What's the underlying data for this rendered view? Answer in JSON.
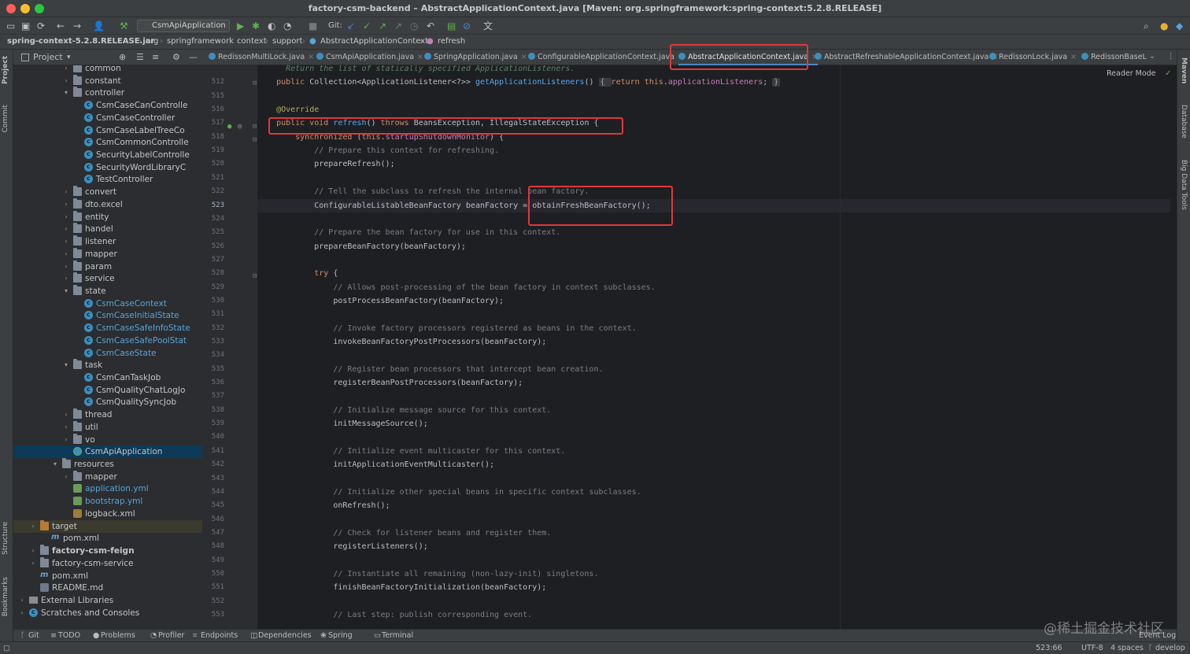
{
  "window": {
    "title": "factory-csm-backend – AbstractApplicationContext.java [Maven: org.springframework:spring-context:5.2.8.RELEASE]",
    "traffic_colors": [
      "#fe5f57",
      "#febc2e",
      "#28c840"
    ]
  },
  "toolbar": {
    "run_config": "CsmApiApplication",
    "git_label": "Git:"
  },
  "breadcrumb": [
    "spring-context-5.2.8.RELEASE.jar",
    "org",
    "springframework",
    "context",
    "support",
    "AbstractApplicationContext",
    "refresh"
  ],
  "left_strip": {
    "project": "Project",
    "commit": "Commit",
    "structure": "Structure",
    "bookmarks": "Bookmarks"
  },
  "right_strip": {
    "maven": "Maven",
    "database": "Database",
    "bigdata": "Big Data Tools"
  },
  "project_panel": {
    "title": "Project"
  },
  "tree": [
    {
      "label": "common",
      "icon": "folder-icon",
      "depth": 4,
      "chevron": "›"
    },
    {
      "label": "constant",
      "icon": "folder-icon",
      "depth": 4,
      "chevron": "›"
    },
    {
      "label": "controller",
      "icon": "folder-icon",
      "depth": 4,
      "chevron": "⌄"
    },
    {
      "label": "CsmCaseCanControlle",
      "icon": "class-icon",
      "depth": 5
    },
    {
      "label": "CsmCaseController",
      "icon": "class-icon",
      "depth": 5
    },
    {
      "label": "CsmCaseLabelTreeCo",
      "icon": "class-icon",
      "depth": 5
    },
    {
      "label": "CsmCommonControlle",
      "icon": "class-icon",
      "depth": 5
    },
    {
      "label": "SecurityLabelControlle",
      "icon": "class-icon",
      "depth": 5
    },
    {
      "label": "SecurityWordLibraryC",
      "icon": "class-icon",
      "depth": 5
    },
    {
      "label": "TestController",
      "icon": "class-icon",
      "depth": 5
    },
    {
      "label": "convert",
      "icon": "folder-icon",
      "depth": 4,
      "chevron": "›"
    },
    {
      "label": "dto.excel",
      "icon": "folder-icon",
      "depth": 4,
      "chevron": "›"
    },
    {
      "label": "entity",
      "icon": "folder-icon",
      "depth": 4,
      "chevron": "›"
    },
    {
      "label": "handel",
      "icon": "folder-icon",
      "depth": 4,
      "chevron": "›"
    },
    {
      "label": "listener",
      "icon": "folder-icon",
      "depth": 4,
      "chevron": "›"
    },
    {
      "label": "mapper",
      "icon": "folder-icon",
      "depth": 4,
      "chevron": "›"
    },
    {
      "label": "param",
      "icon": "folder-icon",
      "depth": 4,
      "chevron": "›"
    },
    {
      "label": "service",
      "icon": "folder-icon",
      "depth": 4,
      "chevron": "›"
    },
    {
      "label": "state",
      "icon": "folder-icon",
      "depth": 4,
      "chevron": "⌄"
    },
    {
      "label": "CsmCaseContext",
      "icon": "class-icon",
      "depth": 5,
      "blue": true
    },
    {
      "label": "CsmCaseInitialState",
      "icon": "class-icon",
      "depth": 5,
      "blue": true
    },
    {
      "label": "CsmCaseSafeInfoState",
      "icon": "class-icon",
      "depth": 5,
      "blue": true
    },
    {
      "label": "CsmCaseSafePoolStat",
      "icon": "class-icon",
      "depth": 5,
      "blue": true
    },
    {
      "label": "CsmCaseState",
      "icon": "class-icon",
      "depth": 5,
      "blue": true
    },
    {
      "label": "task",
      "icon": "folder-icon",
      "depth": 4,
      "chevron": "⌄"
    },
    {
      "label": "CsmCanTaskJob",
      "icon": "class-icon",
      "depth": 5
    },
    {
      "label": "CsmQualityChatLogJo",
      "icon": "class-icon",
      "depth": 5
    },
    {
      "label": "CsmQualitySyncJob",
      "icon": "class-icon",
      "depth": 5
    },
    {
      "label": "thread",
      "icon": "folder-icon",
      "depth": 4,
      "chevron": "›"
    },
    {
      "label": "util",
      "icon": "folder-icon",
      "depth": 4,
      "chevron": "›"
    },
    {
      "label": "vo",
      "icon": "folder-icon",
      "depth": 4,
      "chevron": "›"
    },
    {
      "label": "CsmApiApplication",
      "icon": "app-class-icon",
      "depth": 4,
      "selected": true
    },
    {
      "label": "resources",
      "icon": "folder-icon",
      "depth": 3,
      "chevron": "⌄"
    },
    {
      "label": "mapper",
      "icon": "folder-icon",
      "depth": 4,
      "chevron": "›"
    },
    {
      "label": "application.yml",
      "icon": "yaml-icon",
      "depth": 4,
      "blue": true
    },
    {
      "label": "bootstrap.yml",
      "icon": "yaml-icon",
      "depth": 4,
      "blue": true
    },
    {
      "label": "logback.xml",
      "icon": "xml-icon",
      "depth": 4
    },
    {
      "label": "target",
      "icon": "folder-orange-icon",
      "depth": 1,
      "chevron": "›",
      "highlight": true
    },
    {
      "label": "pom.xml",
      "icon": "maven-icon",
      "depth": 2
    },
    {
      "label": "factory-csm-feign",
      "icon": "folder-icon",
      "depth": 1,
      "chevron": "›",
      "bold": true
    },
    {
      "label": "factory-csm-service",
      "icon": "folder-icon",
      "depth": 1,
      "chevron": "›"
    },
    {
      "label": "pom.xml",
      "icon": "maven-icon",
      "depth": 1
    },
    {
      "label": "README.md",
      "icon": "markdown-icon",
      "depth": 1
    },
    {
      "label": "External Libraries",
      "icon": "library-icon",
      "depth": 0,
      "chevron": "›"
    },
    {
      "label": "Scratches and Consoles",
      "icon": "scratch-icon",
      "depth": 0,
      "chevron": "›"
    }
  ],
  "tabs": [
    {
      "label": "RedissonMultiLock.java"
    },
    {
      "label": "CsmApiApplication.java"
    },
    {
      "label": "SpringApplication.java"
    },
    {
      "label": "ConfigurableApplicationContext.java"
    },
    {
      "label": "AbstractApplicationContext.java",
      "active": true
    },
    {
      "label": "AbstractRefreshableApplicationContext.java"
    },
    {
      "label": "RedissonLock.java"
    },
    {
      "label": "RedissonBaseL"
    }
  ],
  "editor": {
    "reader_mode": "Reader Mode",
    "lines": [
      {
        "n": "",
        "tokens": [
          [
            "doc",
            "      Return the list of statically specified ApplicationListeners."
          ]
        ]
      },
      {
        "n": "512",
        "tokens": [
          [
            "kw",
            "    public "
          ],
          [
            "df",
            "Collection<ApplicationListener<?>> "
          ],
          [
            "fn",
            "getApplicationListeners"
          ],
          [
            "df",
            "() "
          ],
          [
            "fold",
            "{ "
          ],
          [
            "kw",
            "return this"
          ],
          [
            "df",
            "."
          ],
          [
            "fld",
            "applicationListeners"
          ],
          [
            "df",
            "; "
          ],
          [
            "fold",
            "}"
          ]
        ]
      },
      {
        "n": "515",
        "tokens": []
      },
      {
        "n": "516",
        "tokens": [
          [
            "an",
            "    @Override"
          ]
        ]
      },
      {
        "n": "517",
        "tokens": [
          [
            "kw",
            "    public void "
          ],
          [
            "fn",
            "refresh"
          ],
          [
            "df",
            "() "
          ],
          [
            "kw",
            "throws "
          ],
          [
            "df",
            "BeansException, IllegalStateException {"
          ]
        ]
      },
      {
        "n": "518",
        "tokens": [
          [
            "kw",
            "        synchronized "
          ],
          [
            "df",
            "("
          ],
          [
            "kw",
            "this"
          ],
          [
            "df",
            "."
          ],
          [
            "fld",
            "startupShutdownMonitor"
          ],
          [
            "df",
            ") {"
          ]
        ]
      },
      {
        "n": "519",
        "tokens": [
          [
            "cm",
            "            // Prepare this context for refreshing."
          ]
        ]
      },
      {
        "n": "520",
        "tokens": [
          [
            "df",
            "            prepareRefresh();"
          ]
        ]
      },
      {
        "n": "521",
        "tokens": []
      },
      {
        "n": "522",
        "tokens": [
          [
            "cm",
            "            // Tell the subclass to refresh the internal bean factory."
          ]
        ]
      },
      {
        "n": "523",
        "tokens": [
          [
            "df",
            "            ConfigurableListableBeanFactory beanFactory = obtainFreshBeanFactory();"
          ]
        ],
        "current": true
      },
      {
        "n": "524",
        "tokens": []
      },
      {
        "n": "525",
        "tokens": [
          [
            "cm",
            "            // Prepare the bean factory for use in this context."
          ]
        ]
      },
      {
        "n": "526",
        "tokens": [
          [
            "df",
            "            prepareBeanFactory(beanFactory);"
          ]
        ]
      },
      {
        "n": "527",
        "tokens": []
      },
      {
        "n": "528",
        "tokens": [
          [
            "kw",
            "            try "
          ],
          [
            "df",
            "{"
          ]
        ]
      },
      {
        "n": "529",
        "tokens": [
          [
            "cm",
            "                // Allows post-processing of the bean factory in context subclasses."
          ]
        ]
      },
      {
        "n": "530",
        "tokens": [
          [
            "df",
            "                postProcessBeanFactory(beanFactory);"
          ]
        ]
      },
      {
        "n": "531",
        "tokens": []
      },
      {
        "n": "532",
        "tokens": [
          [
            "cm",
            "                // Invoke factory processors registered as beans in the context."
          ]
        ]
      },
      {
        "n": "533",
        "tokens": [
          [
            "df",
            "                invokeBeanFactoryPostProcessors(beanFactory);"
          ]
        ]
      },
      {
        "n": "534",
        "tokens": []
      },
      {
        "n": "535",
        "tokens": [
          [
            "cm",
            "                // Register bean processors that intercept bean creation."
          ]
        ]
      },
      {
        "n": "536",
        "tokens": [
          [
            "df",
            "                registerBeanPostProcessors(beanFactory);"
          ]
        ]
      },
      {
        "n": "537",
        "tokens": []
      },
      {
        "n": "538",
        "tokens": [
          [
            "cm",
            "                // Initialize message source for this context."
          ]
        ]
      },
      {
        "n": "539",
        "tokens": [
          [
            "df",
            "                initMessageSource();"
          ]
        ]
      },
      {
        "n": "540",
        "tokens": []
      },
      {
        "n": "541",
        "tokens": [
          [
            "cm",
            "                // Initialize event multicaster for this context."
          ]
        ]
      },
      {
        "n": "542",
        "tokens": [
          [
            "df",
            "                initApplicationEventMulticaster();"
          ]
        ]
      },
      {
        "n": "543",
        "tokens": []
      },
      {
        "n": "544",
        "tokens": [
          [
            "cm",
            "                // Initialize other special beans in specific context subclasses."
          ]
        ]
      },
      {
        "n": "545",
        "tokens": [
          [
            "df",
            "                onRefresh();"
          ]
        ]
      },
      {
        "n": "546",
        "tokens": []
      },
      {
        "n": "547",
        "tokens": [
          [
            "cm",
            "                // Check for listener beans and register them."
          ]
        ]
      },
      {
        "n": "548",
        "tokens": [
          [
            "df",
            "                registerListeners();"
          ]
        ]
      },
      {
        "n": "549",
        "tokens": []
      },
      {
        "n": "550",
        "tokens": [
          [
            "cm",
            "                // Instantiate all remaining (non-lazy-init) singletons."
          ]
        ]
      },
      {
        "n": "551",
        "tokens": [
          [
            "df",
            "                finishBeanFactoryInitialization(beanFactory);"
          ]
        ]
      },
      {
        "n": "552",
        "tokens": []
      },
      {
        "n": "553",
        "tokens": [
          [
            "cm",
            "                // Last step: publish corresponding event."
          ]
        ]
      }
    ]
  },
  "tool_windows": [
    "Git",
    "TODO",
    "Problems",
    "Profiler",
    "Endpoints",
    "Dependencies",
    "Spring",
    "Terminal"
  ],
  "event_log": "Event Log",
  "status": {
    "position": "523:66",
    "encoding": "UTF-8",
    "indent": "4 spaces",
    "branch": "develop"
  },
  "watermark": "@稀土掘金技术社区",
  "colors": {
    "highlight_box": "#e0383a",
    "accent": "#4a88c7"
  }
}
